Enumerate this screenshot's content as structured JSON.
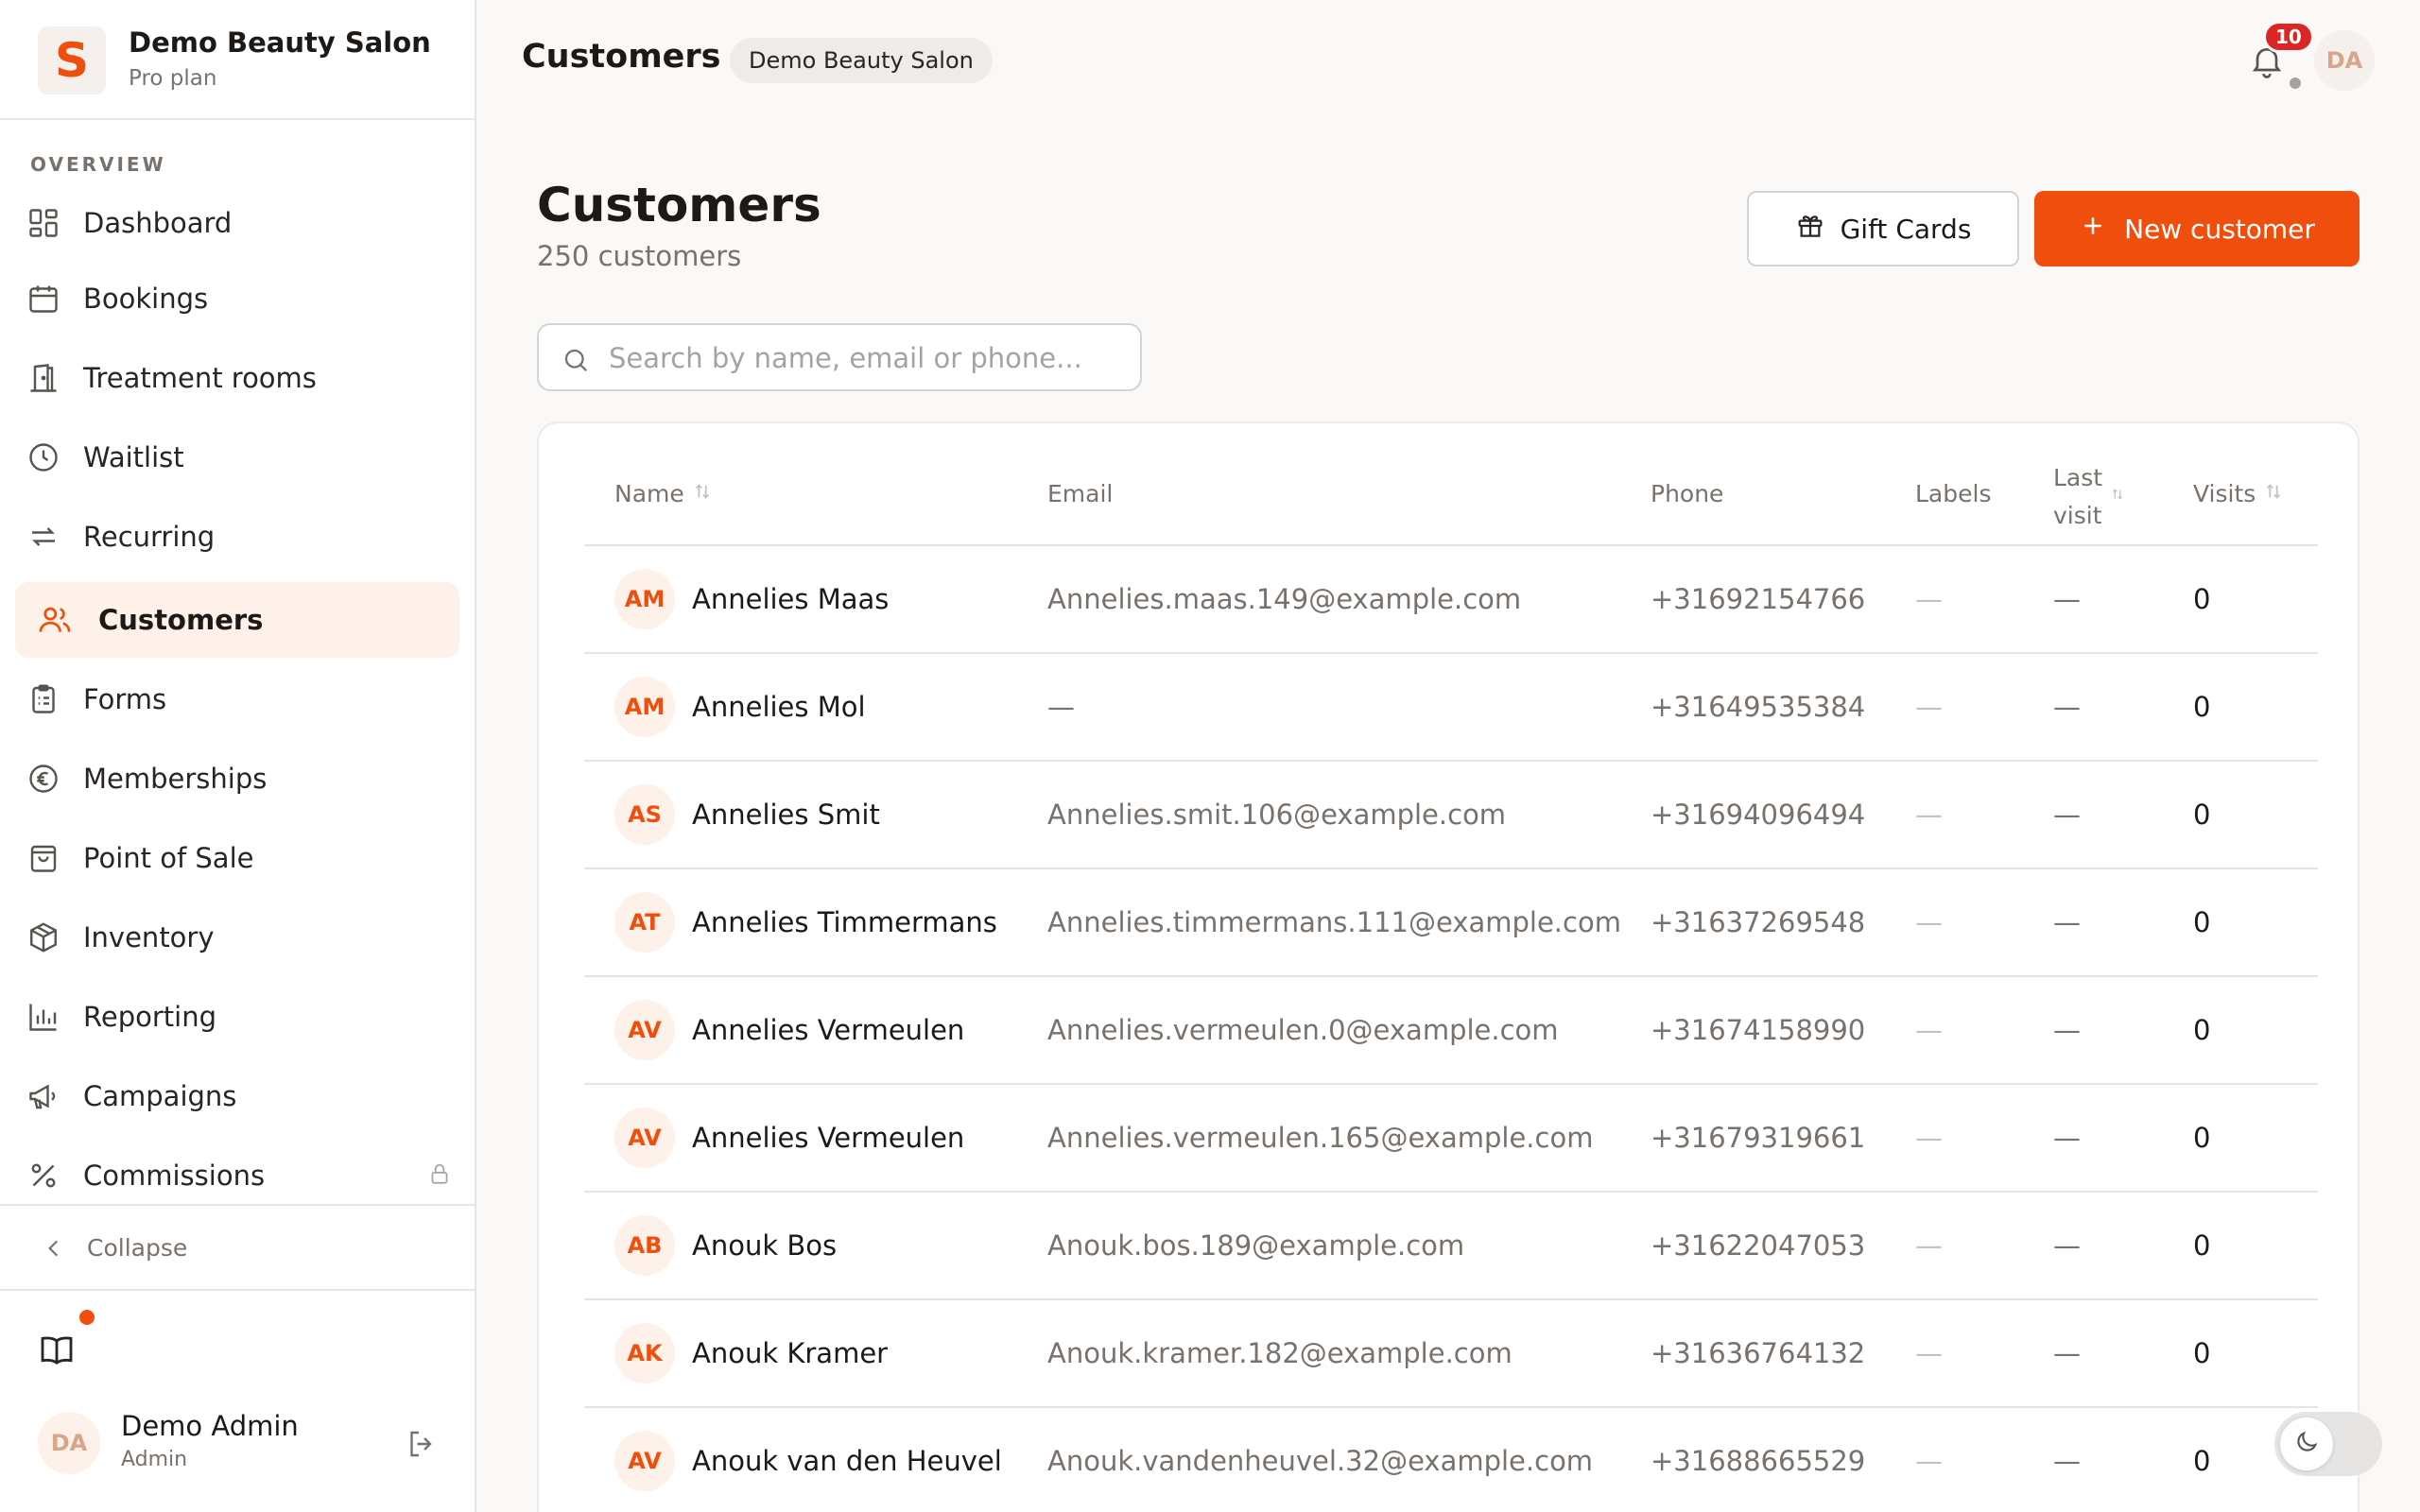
{
  "brand": {
    "logo_letter": "S",
    "name": "Demo Beauty Salon",
    "plan": "Pro plan"
  },
  "sidebar": {
    "section": "OVERVIEW",
    "items": [
      {
        "label": "Dashboard",
        "icon": "dashboard-icon"
      },
      {
        "label": "Bookings",
        "icon": "calendar-icon"
      },
      {
        "label": "Treatment rooms",
        "icon": "door-icon"
      },
      {
        "label": "Waitlist",
        "icon": "clock-icon"
      },
      {
        "label": "Recurring",
        "icon": "repeat-icon"
      },
      {
        "label": "Customers",
        "icon": "users-icon",
        "active": true
      },
      {
        "label": "Forms",
        "icon": "clipboard-icon"
      },
      {
        "label": "Memberships",
        "icon": "euro-icon"
      },
      {
        "label": "Point of Sale",
        "icon": "bag-icon"
      },
      {
        "label": "Inventory",
        "icon": "box-icon"
      },
      {
        "label": "Reporting",
        "icon": "bar-chart-icon"
      },
      {
        "label": "Campaigns",
        "icon": "megaphone-icon"
      },
      {
        "label": "Commissions",
        "icon": "percent-icon",
        "locked": true
      }
    ],
    "collapse_label": "Collapse"
  },
  "user": {
    "initials": "DA",
    "name": "Demo Admin",
    "role": "Admin"
  },
  "topbar": {
    "title": "Customers",
    "org_pill": "Demo Beauty Salon",
    "notification_count": "10",
    "avatar_initials": "DA"
  },
  "page": {
    "title": "Customers",
    "count_text": "250 customers",
    "gift_cards_label": "Gift Cards",
    "new_customer_label": "New customer",
    "search_placeholder": "Search by name, email or phone..."
  },
  "table": {
    "headers": {
      "name": "Name",
      "email": "Email",
      "phone": "Phone",
      "labels": "Labels",
      "last_visit_1": "Last",
      "last_visit_2": "visit",
      "visits": "Visits"
    },
    "rows": [
      {
        "initials": "AM",
        "name": "Annelies Maas",
        "email": "Annelies.maas.149@example.com",
        "phone": "+31692154766",
        "labels": "—",
        "last_visit": "—",
        "visits": "0"
      },
      {
        "initials": "AM",
        "name": "Annelies Mol",
        "email": "—",
        "phone": "+31649535384",
        "labels": "—",
        "last_visit": "—",
        "visits": "0"
      },
      {
        "initials": "AS",
        "name": "Annelies Smit",
        "email": "Annelies.smit.106@example.com",
        "phone": "+31694096494",
        "labels": "—",
        "last_visit": "—",
        "visits": "0"
      },
      {
        "initials": "AT",
        "name": "Annelies Timmermans",
        "email": "Annelies.timmermans.111@example.com",
        "phone": "+31637269548",
        "labels": "—",
        "last_visit": "—",
        "visits": "0"
      },
      {
        "initials": "AV",
        "name": "Annelies Vermeulen",
        "email": "Annelies.vermeulen.0@example.com",
        "phone": "+31674158990",
        "labels": "—",
        "last_visit": "—",
        "visits": "0"
      },
      {
        "initials": "AV",
        "name": "Annelies Vermeulen",
        "email": "Annelies.vermeulen.165@example.com",
        "phone": "+31679319661",
        "labels": "—",
        "last_visit": "—",
        "visits": "0"
      },
      {
        "initials": "AB",
        "name": "Anouk Bos",
        "email": "Anouk.bos.189@example.com",
        "phone": "+31622047053",
        "labels": "—",
        "last_visit": "—",
        "visits": "0"
      },
      {
        "initials": "AK",
        "name": "Anouk Kramer",
        "email": "Anouk.kramer.182@example.com",
        "phone": "+31636764132",
        "labels": "—",
        "last_visit": "—",
        "visits": "0"
      },
      {
        "initials": "AV",
        "name": "Anouk van den Heuvel",
        "email": "Anouk.vandenheuvel.32@example.com",
        "phone": "+31688665529",
        "labels": "—",
        "last_visit": "—",
        "visits": "0"
      }
    ]
  },
  "colors": {
    "accent": "#f04e0c",
    "badge": "#dc2626",
    "active_bg": "#fef1ea"
  }
}
